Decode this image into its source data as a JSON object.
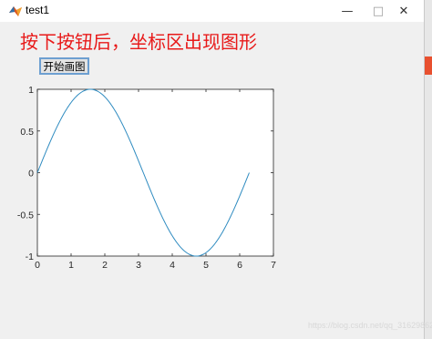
{
  "window": {
    "title": "test1",
    "controls": {
      "minimize": "—",
      "maximize": "□",
      "close": "✕"
    }
  },
  "heading": "按下按钮后，坐标区出现图形",
  "button": {
    "label": "开始画图"
  },
  "colors": {
    "line": "#2e8bc0",
    "heading": "#e81a1a",
    "button_border": "#6d9fd1"
  },
  "axes": {
    "x_ticks": [
      "0",
      "1",
      "2",
      "3",
      "4",
      "5",
      "6",
      "7"
    ],
    "y_ticks": [
      "1",
      "0.5",
      "0",
      "-0.5",
      "-1"
    ]
  },
  "chart_data": {
    "type": "line",
    "function": "sin(x)",
    "xlim": [
      0,
      7
    ],
    "ylim": [
      -1,
      1
    ],
    "x": [
      0,
      0.5,
      1,
      1.5708,
      2,
      2.5,
      3,
      3.5,
      4,
      4.7124,
      5,
      5.5,
      6,
      6.2832
    ],
    "y": [
      0,
      0.479,
      0.841,
      1,
      0.909,
      0.598,
      0.141,
      -0.351,
      -0.757,
      -1,
      -0.959,
      -0.706,
      -0.279,
      0
    ]
  },
  "watermark": "https://blog.csdn.net/qq_31629862"
}
